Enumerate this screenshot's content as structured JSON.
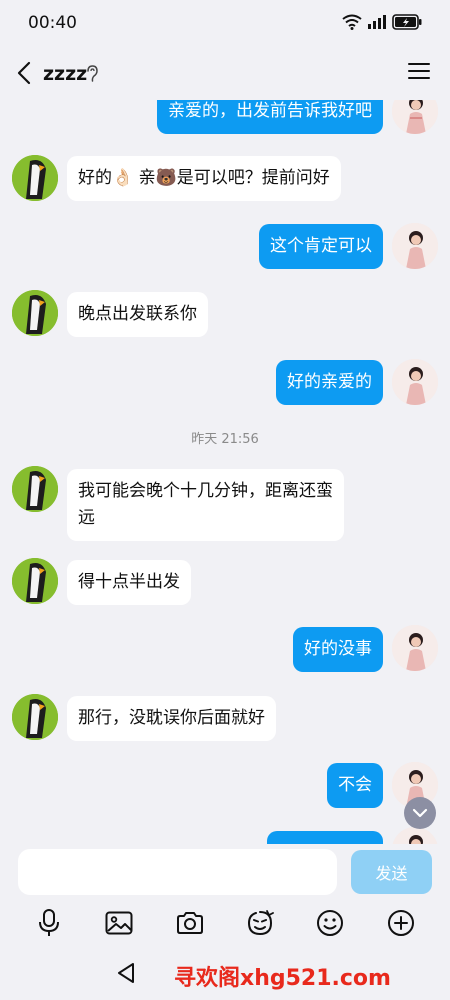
{
  "status_bar": {
    "time": "00:40"
  },
  "header": {
    "title": "zzzz"
  },
  "messages": [
    {
      "side": "out",
      "text": "亲爱的，出发前告诉我好吧"
    },
    {
      "side": "in",
      "text": "好的👌🏻 亲🐻是可以吧？提前问好"
    },
    {
      "side": "out",
      "text": "这个肯定可以"
    },
    {
      "side": "in",
      "text": "晚点出发联系你"
    },
    {
      "side": "out",
      "text": "好的亲爱的"
    },
    {
      "side": "in",
      "text_line1": "我可能会晚个十几分钟，距离还蛮",
      "text_line2": "远"
    },
    {
      "side": "in",
      "text": "得十点半出发"
    },
    {
      "side": "out",
      "text": "好的没事"
    },
    {
      "side": "in",
      "text": "那行，没耽误你后面就好"
    },
    {
      "side": "out",
      "text": "不会"
    }
  ],
  "timestamp": "昨天 21:56",
  "input": {
    "send_label": "发送"
  },
  "toolbar_icons": [
    "mic-icon",
    "image-icon",
    "camera-icon",
    "sticker-icon",
    "emoji-icon",
    "plus-icon"
  ],
  "watermark": "寻欢阁xhg521.com",
  "colors": {
    "outgoing_bubble": "#0d9bf2",
    "incoming_bubble": "#ffffff",
    "background": "#f1f1f5",
    "send_button": "#8fd0f5",
    "watermark": "#e8291c"
  }
}
